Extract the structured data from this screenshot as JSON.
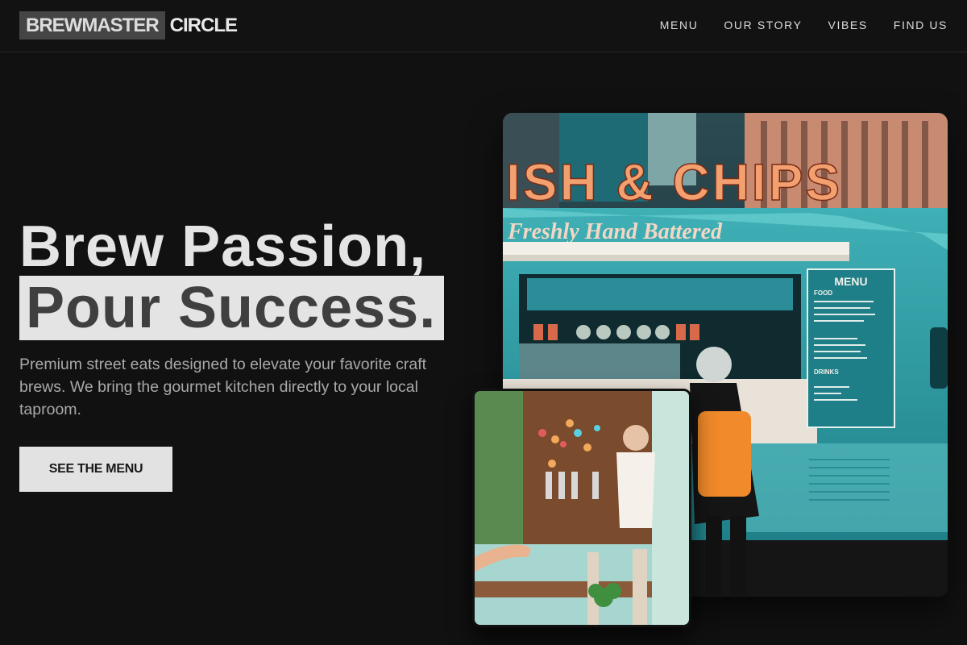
{
  "brand": {
    "box": "BREWMASTER",
    "rest": "CIRCLE"
  },
  "nav": [
    {
      "label": "MENU"
    },
    {
      "label": "OUR STORY"
    },
    {
      "label": "VIBES"
    },
    {
      "label": "FIND US"
    }
  ],
  "hero": {
    "line1": "Brew Passion,",
    "line2": "Pour Success.",
    "description": "Premium street eats designed to elevate your favorite craft brews. We bring the gourmet kitchen directly to your local taproom.",
    "cta": "SEE THE MENU"
  },
  "photo_main": {
    "sign": "ISH & CHIPS",
    "banner": "Freshly Hand Battered",
    "menu_board": {
      "title": "MENU",
      "food_heading": "FOOD",
      "drinks_heading": "DRINKS"
    }
  },
  "colors": {
    "background": "#111111",
    "accent": "#e2e2e2",
    "muted_text": "#a9a9a9",
    "truck_teal": "#2e9fa8"
  }
}
